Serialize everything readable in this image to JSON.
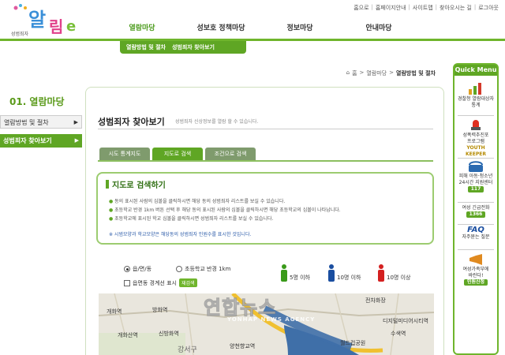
{
  "header": {
    "logo_text": "알림e",
    "logo_sub": "성범죄자",
    "util_links": [
      "홈으로",
      "홈페이지안내",
      "사이트맵",
      "찾아오시는 길",
      "로그아웃"
    ]
  },
  "gnb": [
    "열람마당",
    "성보호 정책마당",
    "정보마당",
    "안내마당"
  ],
  "subnav": [
    "열람방법 및 절차",
    "성범죄자 찾아보기"
  ],
  "left_nav": {
    "title": "01. 열람마당",
    "items": [
      "열람방법 및 절차",
      "성범죄자 찾아보기"
    ]
  },
  "breadcrumb": [
    "홈",
    "열람마당",
    "열람방법 및 절차"
  ],
  "page": {
    "title": "성범죄자 찾아보기",
    "desc": "성범죄자 신상정보를 열람 할 수 있습니다."
  },
  "tabs": [
    "시도 통계지도",
    "지도로 검색",
    "조건으로 검색"
  ],
  "active_tab": 1,
  "infobox": {
    "title": "지도로 검색하기",
    "bullets": [
      "동의 표시된 사람의 심볼을 클릭하시면 해당 동의 성범죄자 리스트를 보실 수 있습니다.",
      "초등학교 반경 1km 버튼 선택 후 해당 동의 표시된 사람의 심볼을 클릭하시면 해당 초등학교의 심볼이 나타납니다.",
      "초등학교에 표시된 학교 심볼을 클릭하시면 성범죄자 리스트를 보실 수 있습니다."
    ],
    "note": "※ 시범모양과 학교모양은 해당동의 성범죄자 인원수를 표시한 것입니다."
  },
  "map_controls": {
    "radio1": "읍/면/동",
    "radio2": "초등학교 반경 1km",
    "checkbox": "읍면동 경계선 표시",
    "apply": "재검색"
  },
  "legend": [
    {
      "label": "5명 이하",
      "color": "#3a9a1a"
    },
    {
      "label": "10명 이하",
      "color": "#1a4ea0"
    },
    {
      "label": "10명 이상",
      "color": "#d42020"
    }
  ],
  "map_labels": [
    "개화역",
    "개화산역",
    "방화역",
    "신방화역",
    "강서구",
    "양천향교역",
    "전차화장",
    "월드컵공원",
    "디지털미디어시티역",
    "수색역"
  ],
  "watermark": {
    "main": "연합뉴스",
    "sub": "YONHAP NEWS AGENCY"
  },
  "quick_menu": {
    "title": "Quick Menu",
    "items": [
      {
        "line1": "경찰청 열람대상자",
        "line2": "통계"
      },
      {
        "line1": "성폭력추진포",
        "line2": "프로그램",
        "tag": "YOUTH KEEPER"
      },
      {
        "line1": "피해 아동·청소년",
        "line2": "24시간 지원센터",
        "num": "117"
      },
      {
        "line1": "여성 긴급전화",
        "num": "1366"
      },
      {
        "faq": "FAQ",
        "line1": "자주묻는 질문"
      },
      {
        "line1": "여성가족부에",
        "line2": "바란다!",
        "tag2": "민원신청"
      }
    ]
  },
  "colors": {
    "brand_green": "#5fa624",
    "dark_green": "#2f6f12",
    "note_blue": "#2a5aa8"
  }
}
